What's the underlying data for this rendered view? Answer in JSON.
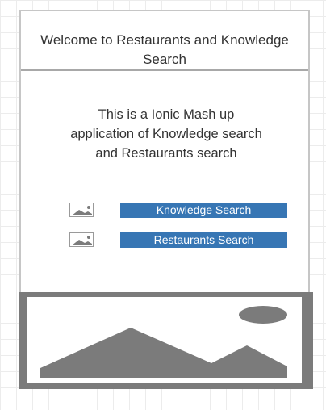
{
  "header": {
    "title": "Welcome to Restaurants and Knowledge Search"
  },
  "description": {
    "line1": "This is a Ionic Mash up",
    "line2": "application of Knowledge search",
    "line3": "and  Restaurants search"
  },
  "nav": [
    {
      "label": "Knowledge Search",
      "icon": "image-placeholder-icon"
    },
    {
      "label": "Restaurants Search",
      "icon": "image-placeholder-icon"
    }
  ],
  "hero": {
    "icon": "image-placeholder-icon"
  },
  "colors": {
    "button_bg": "#3776b4",
    "button_text": "#ffffff",
    "placeholder_gray": "#7b7b7b",
    "text": "#333333"
  }
}
